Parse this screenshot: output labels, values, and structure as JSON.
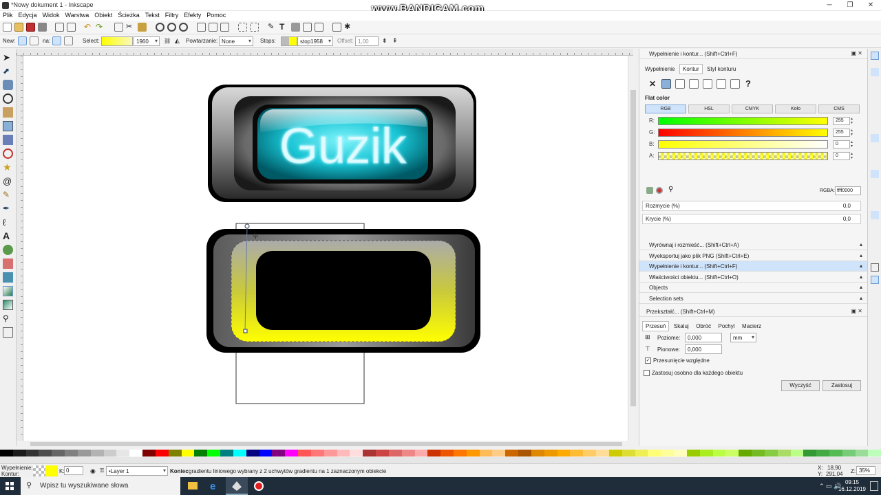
{
  "window": {
    "title": "*Nowy dokument 1 - Inkscape",
    "watermark": "www.BANDICAM.com",
    "min": "─",
    "max": "❐",
    "close": "✕"
  },
  "menu": [
    "Plik",
    "Edycja",
    "Widok",
    "Warstwa",
    "Obiekt",
    "Ścieżka",
    "Tekst",
    "Filtry",
    "Efekty",
    "Pomoc"
  ],
  "controls": {
    "new_label": "New:",
    "on_label": "na:",
    "select_label": "Select:",
    "select_value": "1960",
    "repeat_label": "Powtarzanie:",
    "repeat_value": "None",
    "stops_label": "Stops:",
    "stop_value": "stop1958",
    "offset_label": "Offset:",
    "offset_value": "1,00"
  },
  "canvas": {
    "button_text": "Guzik",
    "colors": {
      "cyan": "#00c8d8",
      "yellow": "#ffff00",
      "black": "#000000"
    }
  },
  "panel": {
    "fill_stroke_title": "Wypełnienie i kontur... (Shift+Ctrl+F)",
    "tabs": [
      "Wypełnienie",
      "Kontur",
      "Styl konturu"
    ],
    "flat_color": "Flat color",
    "modes": [
      "RGB",
      "HSL",
      "CMYK",
      "Koło",
      "CMS"
    ],
    "channels": [
      {
        "label": "R:",
        "value": "255"
      },
      {
        "label": "G:",
        "value": "255"
      },
      {
        "label": "B:",
        "value": "0"
      },
      {
        "label": "A:",
        "value": "0"
      }
    ],
    "rgba_label": "RGBA:",
    "rgba_value": "ffff0000",
    "blur_label": "Rozmycie (%)",
    "blur_value": "0,0",
    "opacity_label": "Krycie (%)",
    "opacity_value": "0,0",
    "docked": [
      "Wyrównaj i rozmieść... (Shift+Ctrl+A)",
      "Wyeksportuj jako plik PNG (Shift+Ctrl+E)",
      "Wypełnienie i kontur... (Shift+Ctrl+F)",
      "Właściwości obiektu... (Shift+Ctrl+O)",
      "Objects",
      "Selection sets"
    ],
    "transform_title": "Przekształć... (Shift+Ctrl+M)",
    "transform_tabs": [
      "Przesuń",
      "Skaluj",
      "Obróć",
      "Pochyl",
      "Macierz"
    ],
    "horizontal_label": "Poziome:",
    "horizontal_value": "0,000",
    "unit": "mm",
    "vertical_label": "Pionowe:",
    "vertical_value": "0,000",
    "relative_label": "Przesunięcie względne",
    "each_label": "Zastosuj osobno dla każdego obiektu",
    "clear_label": "Wyczyść",
    "apply_label": "Zastosuj"
  },
  "status": {
    "fill_label": "Wypełnienie:",
    "stroke_label": "Kontur:",
    "stroke_width_label": "K:",
    "stroke_width": "0",
    "layer": "•Layer 1",
    "message_bold": "Koniec",
    "message": " gradientu liniowego wybrany z 2 uchwytów gradientu na 1 zaznaczonym obiekcie",
    "x_label": "X:",
    "x": "18,90",
    "y_label": "Y:",
    "y": "291,04",
    "z_label": "Z:",
    "zoom": "35%"
  },
  "taskbar": {
    "search": "Wpisz tu wyszukiwane słowa",
    "time": "09:15",
    "date": "16.12.2019"
  }
}
